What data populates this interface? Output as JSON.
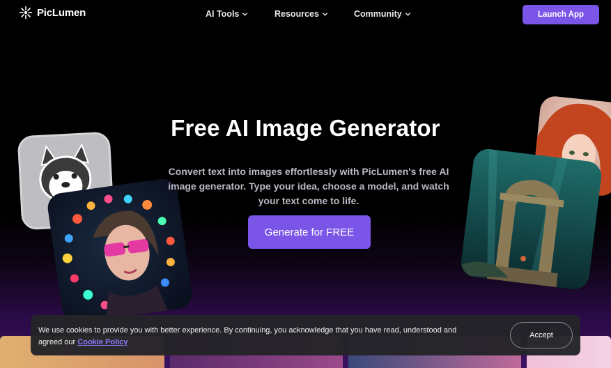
{
  "brand": {
    "name": "PicLumen"
  },
  "nav": {
    "items": [
      {
        "label": "AI Tools"
      },
      {
        "label": "Resources"
      },
      {
        "label": "Community"
      }
    ],
    "launch_label": "Launch App"
  },
  "hero": {
    "title": "Free AI Image Generator",
    "subtitle": "Convert text into images effortlessly with PicLumen's free AI image generator. Type your idea, choose a model, and watch your text come to life.",
    "cta_label": "Generate for FREE"
  },
  "cookie": {
    "text": "We use cookies to provide you with better experience. By continuing, you acknowledge that you have read, understood and agreed our",
    "link_label": "Cookie Policy",
    "accept_label": "Accept"
  },
  "colors": {
    "accent": "#7b55e8",
    "link": "#8f7cff",
    "banner_bg": "#242428"
  },
  "icons": [
    "sparkle-logo-icon",
    "chevron-down-icon"
  ]
}
